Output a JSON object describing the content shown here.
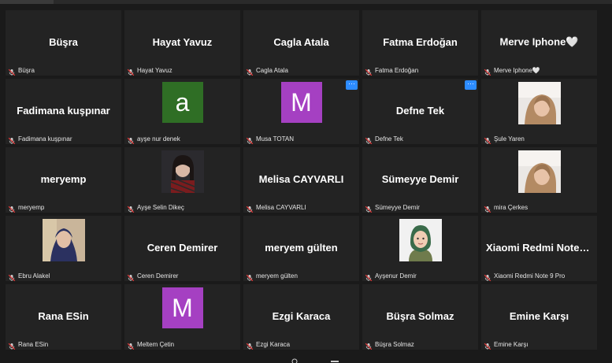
{
  "participants": [
    {
      "display": "Büşra",
      "label": "Büşra",
      "avatar": null,
      "more": false
    },
    {
      "display": "Hayat Yavuz",
      "label": "Hayat Yavuz",
      "avatar": null,
      "more": false
    },
    {
      "display": "Cagla Atala",
      "label": "Cagla Atala",
      "avatar": null,
      "more": false
    },
    {
      "display": "Fatma Erdoğan",
      "label": "Fatma Erdoğan",
      "avatar": null,
      "more": false
    },
    {
      "display": "Merve  Iphone🤍",
      "label": "Merve Iphone🤍",
      "avatar": null,
      "more": false
    },
    {
      "display": "Fadimana  kuşpınar",
      "label": "Fadimana kuşpınar",
      "avatar": null,
      "more": false
    },
    {
      "display": "",
      "label": "ayşe nur denek",
      "avatar": {
        "letter": "a",
        "color": "#2f6e25"
      },
      "more": false
    },
    {
      "display": "",
      "label": "Musa TOTAN",
      "avatar": {
        "letter": "M",
        "color": "#a540c2"
      },
      "more": true
    },
    {
      "display": "Defne Tek",
      "label": "Defne Tek",
      "avatar": null,
      "more": true
    },
    {
      "display": "",
      "label": "Şule Yaren",
      "photo": "selfie-light",
      "more": false
    },
    {
      "display": "meryemp",
      "label": "meryemp",
      "avatar": null,
      "more": false
    },
    {
      "display": "",
      "label": "Ayşe Selin Dikeç",
      "photo": "portrait-dark",
      "more": false
    },
    {
      "display": "Melisa CAYVARLI",
      "label": "Melisa CAYVARLI",
      "avatar": null,
      "more": false
    },
    {
      "display": "Sümeyye Demir",
      "label": "Sümeyye Demir",
      "avatar": null,
      "more": false
    },
    {
      "display": "",
      "label": "mira Çerkes",
      "photo": "selfie-light-2",
      "more": false
    },
    {
      "display": "",
      "label": "Ebru Alakel",
      "photo": "hijab-portrait",
      "more": false
    },
    {
      "display": "Ceren Demirer",
      "label": "Ceren Demirer",
      "avatar": null,
      "more": false
    },
    {
      "display": "meryem gülten",
      "label": "meryem gülten",
      "avatar": null,
      "more": false
    },
    {
      "display": "",
      "label": "Ayşenur Demir",
      "photo": "cartoon-avatar",
      "more": false
    },
    {
      "display": "Xiaomi  Redmi  Note 9 Pro",
      "label": "Xiaomi Redmi Note 9 Pro",
      "avatar": null,
      "more": false
    },
    {
      "display": "Rana ESin",
      "label": "Rana ESin",
      "avatar": null,
      "more": false
    },
    {
      "display": "",
      "label": "Meltem Çetin",
      "avatar": {
        "letter": "M",
        "color": "#a540c2"
      },
      "more": false
    },
    {
      "display": "Ezgi Karaca",
      "label": "Ezgi Karaca",
      "avatar": null,
      "more": false
    },
    {
      "display": "Büşra Solmaz",
      "label": "Büşra Solmaz",
      "avatar": null,
      "more": false
    },
    {
      "display": "Emine Karşı",
      "label": "Emine Karşı",
      "avatar": null,
      "more": false
    }
  ],
  "more_icon": "ellipsis-icon",
  "mic_icon": "muted-microphone-icon",
  "colors": {
    "background": "#1a1a1a",
    "tile": "#232323",
    "muted": "#e03b3b",
    "more": "#2d8cff"
  }
}
